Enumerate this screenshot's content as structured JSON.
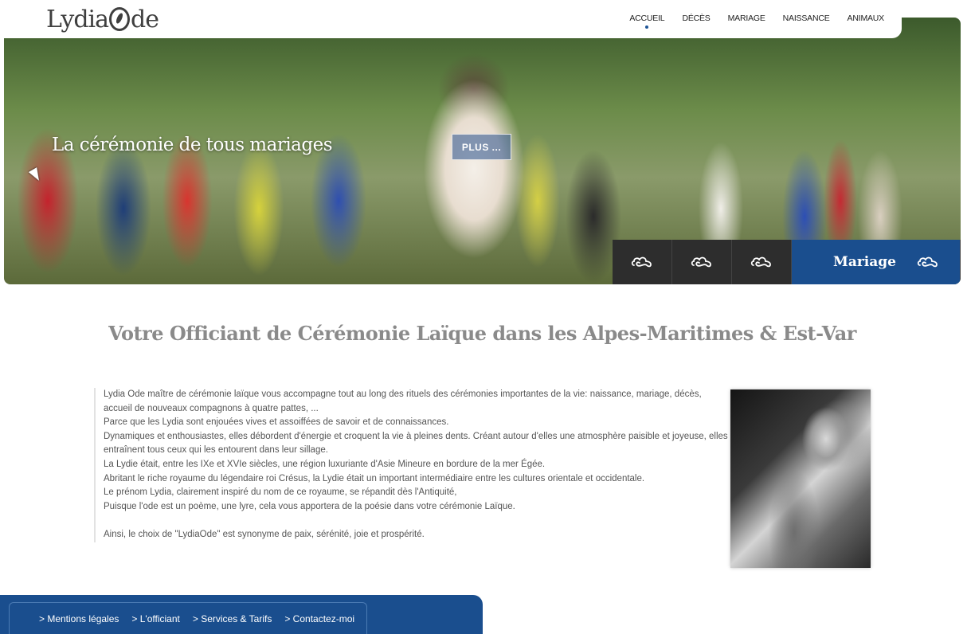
{
  "header": {
    "logo": {
      "text_before": "Lydia",
      "text_after": "de"
    },
    "nav": [
      {
        "label": "ACCUEIL",
        "active": true
      },
      {
        "label": "DÉCÈS",
        "active": false
      },
      {
        "label": "MARIAGE",
        "active": false
      },
      {
        "label": "NAISSANCE",
        "active": false
      },
      {
        "label": "ANIMAUX",
        "active": false
      }
    ]
  },
  "hero": {
    "title": "La cérémonie de tous mariages",
    "plus_button": "PLUS ...",
    "slider": {
      "active_label": "Mariage",
      "icon": "cloud-infinity-icon"
    }
  },
  "main": {
    "title": "Votre Officiant de Cérémonie Laïque dans les Alpes-Maritimes & Est-Var",
    "paragraphs": [
      "Lydia Ode maître de cérémonie laïque vous accompagne tout au long des rituels des cérémonies importantes de la vie: naissance, mariage, décès, accueil de nouveaux compagnons à quatre pattes, ...",
      "Parce que les Lydia sont enjouées vives et assoiffées de savoir et de connaissances.",
      "Dynamiques et enthousiastes, elles débordent d'énergie et croquent la vie à pleines dents. Créant autour d'elles une atmosphère paisible et joyeuse, elles entraînent tous ceux qui les entourent dans leur sillage.",
      "La Lydie était, entre les IXe et XVIe siècles, une région luxuriante d'Asie Mineure en bordure de la mer Égée.",
      "Abritant le riche royaume du légendaire roi Crésus, la Lydie était un important intermédiaire entre les cultures orientale et occidentale.",
      "Le prénom Lydia, clairement inspiré du nom de ce royaume, se répandit dès l'Antiquité,",
      "Puisque l'ode est un poème, une lyre, cela vous apportera  de la poésie  dans votre cérémonie Laïque.",
      "",
      "Ainsi, le choix de \"LydiaOde\" est synonyme de paix, sérénité, joie et prospérité."
    ]
  },
  "footer": {
    "links": [
      "> Mentions légales",
      "> L'officiant",
      "> Services & Tarifs",
      "> Contactez-moi"
    ]
  },
  "colors": {
    "brand_blue": "#1a4e8e",
    "dark_slot": "#2d2d2d",
    "title_gray": "#8a8a8a"
  }
}
